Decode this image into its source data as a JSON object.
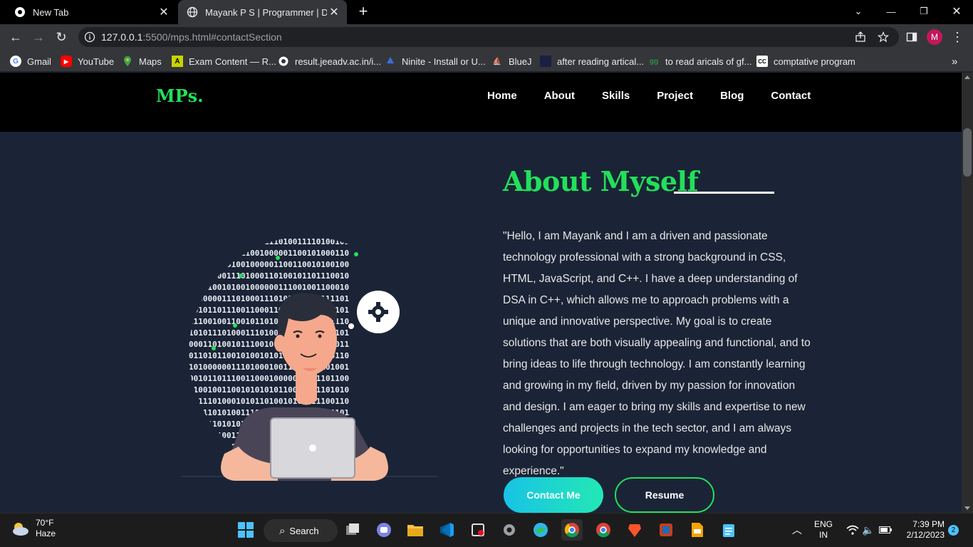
{
  "browser": {
    "tabs": [
      {
        "title": "New Tab",
        "active": false
      },
      {
        "title": "Mayank P S | Programmer | Deve",
        "active": true
      }
    ],
    "url_host": "127.0.0.1",
    "url_rest": ":5500/mps.html#contactSection",
    "profile_initial": "M",
    "bookmarks": [
      {
        "label": "Gmail",
        "icon": "gmail-icon"
      },
      {
        "label": "YouTube",
        "icon": "youtube-icon"
      },
      {
        "label": "Maps",
        "icon": "maps-icon"
      },
      {
        "label": "Exam Content — R...",
        "icon": "exam-icon"
      },
      {
        "label": "result.jeeadv.ac.in/i...",
        "icon": "globe-icon"
      },
      {
        "label": "Ninite - Install or U...",
        "icon": "ninite-icon"
      },
      {
        "label": "BlueJ",
        "icon": "bluej-icon"
      },
      {
        "label": "after reading artical...",
        "icon": "page-icon"
      },
      {
        "label": "to read aricals of gf...",
        "icon": "gfg-icon"
      },
      {
        "label": "comptative program",
        "icon": "cc-icon"
      }
    ]
  },
  "site": {
    "logo": "MPs.",
    "nav": [
      "Home",
      "About",
      "Skills",
      "Project",
      "Blog",
      "Contact"
    ],
    "about": {
      "title": "About Myself",
      "text": "\"Hello, I am Mayank and I am a driven and passionate technology professional with a strong background in CSS, HTML, JavaScript, and C++. I have a deep understanding of DSA in C++, which allows me to approach problems with a unique and innovative perspective. My goal is to create solutions that are both visually appealing and functional, and to bring ideas to life through technology. I am constantly learning and growing in my field, driven by my passion for innovation and design. I am eager to bring my skills and expertise to new challenges and projects in the tech sector, and I am always looking for opportunities to expand my knowledge and experience.\"",
      "contact_btn": "Contact Me",
      "resume_btn": "Resume"
    },
    "colors": {
      "accent": "#22e05a",
      "bg": "#1b2436",
      "nav_bg": "#000000"
    }
  },
  "taskbar": {
    "temp": "70°F",
    "weather": "Haze",
    "search": "Search",
    "lang1": "ENG",
    "lang2": "IN",
    "time": "7:39 PM",
    "date": "2/12/2023",
    "notifications": "2"
  }
}
